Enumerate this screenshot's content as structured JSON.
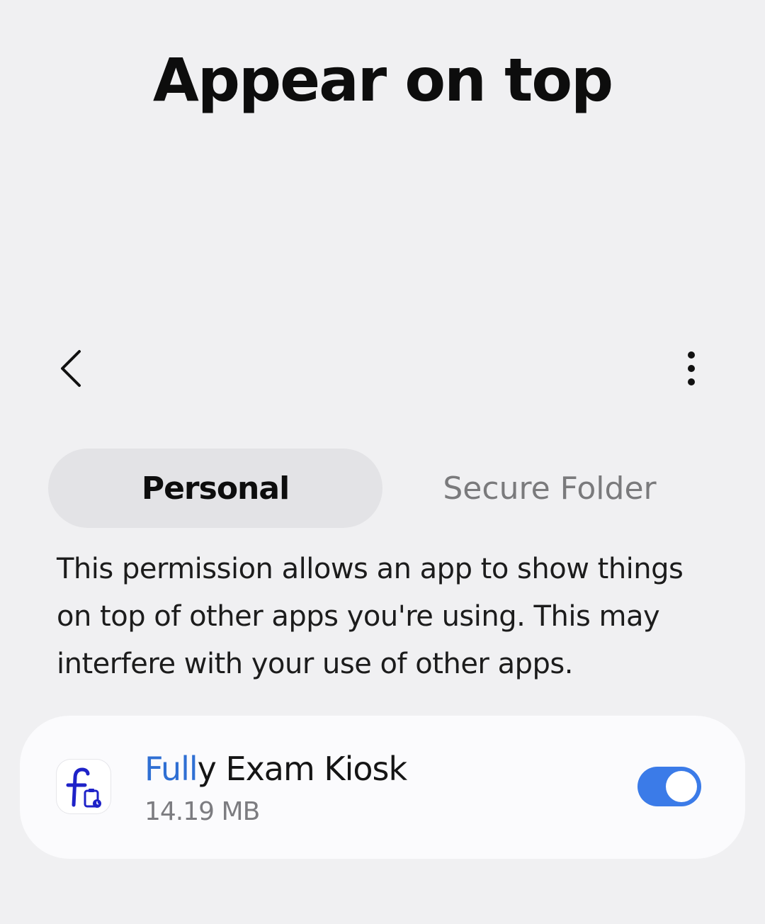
{
  "header": {
    "title": "Appear on top"
  },
  "toolbar": {
    "back_icon": "chevron-left-icon",
    "more_icon": "more-vertical-icon"
  },
  "tabs": [
    {
      "label": "Personal",
      "selected": true
    },
    {
      "label": "Secure Folder",
      "selected": false
    }
  ],
  "description": "This permission allows an app to show things on top of other apps you're using. This may interfere with your use of other apps.",
  "apps": [
    {
      "name_highlight": "Full",
      "name_rest": "y Exam Kiosk",
      "size": "14.19 MB",
      "icon": "fully-exam-kiosk-icon",
      "allowed": true
    }
  ],
  "colors": {
    "accent": "#3b7be8",
    "highlight": "#2f6fd3",
    "background": "#f0f0f2",
    "card": "#fbfbfd"
  }
}
